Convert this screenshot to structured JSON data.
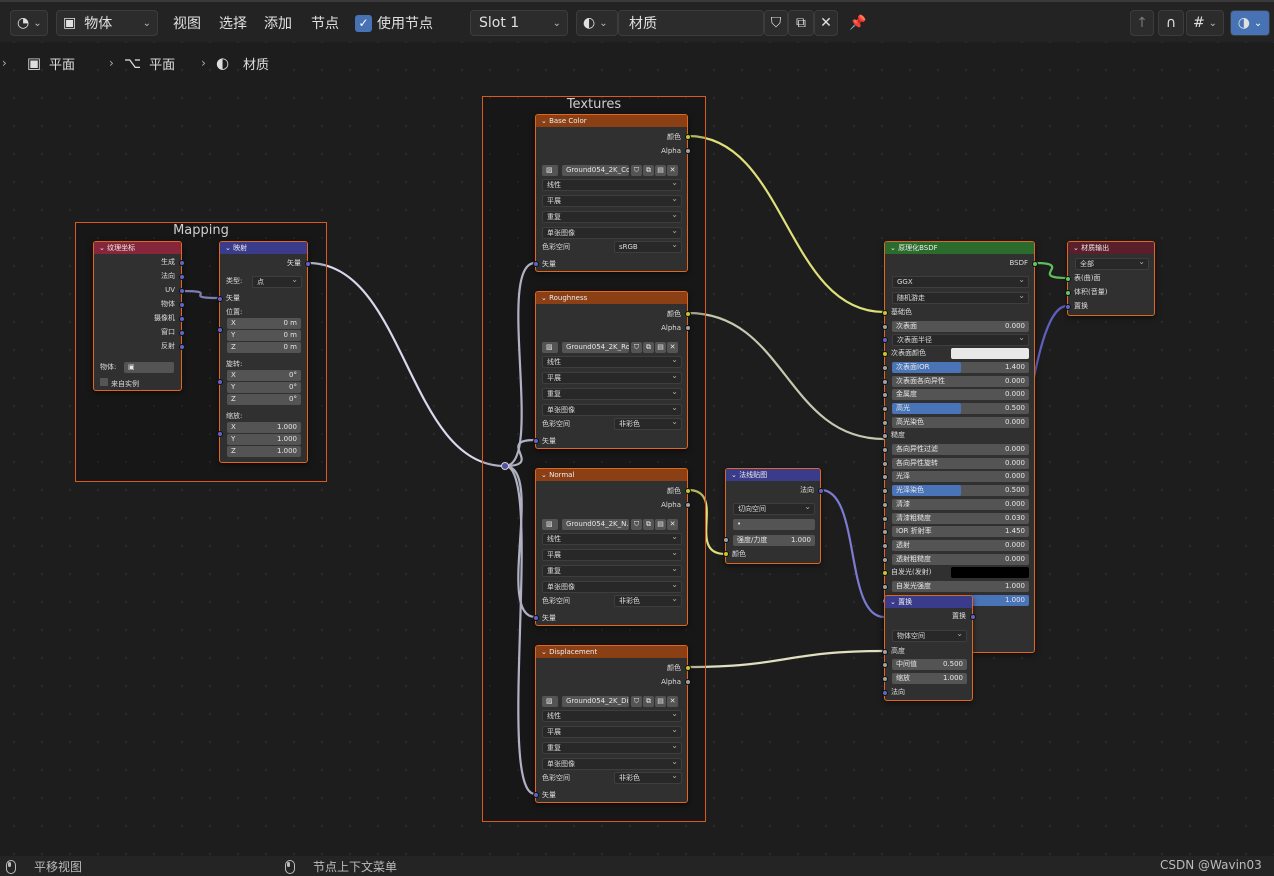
{
  "toolbar": {
    "object_mode": "物体",
    "menu": [
      "视图",
      "选择",
      "添加",
      "节点"
    ],
    "use_nodes": "使用节点",
    "slot": "Slot 1",
    "material": "材质"
  },
  "breadcrumb": [
    "平面",
    "平面",
    "材质"
  ],
  "frames": {
    "mapping": "Mapping",
    "textures": "Textures"
  },
  "texcoord": {
    "title": "纹理坐标",
    "outputs": [
      "生成",
      "法向",
      "UV",
      "物体",
      "摄像机",
      "窗口",
      "反射"
    ],
    "object_label": "物体:",
    "from_instancer": "来自实例"
  },
  "mapping": {
    "title": "映射",
    "out": "矢量",
    "type_label": "类型:",
    "type": "点",
    "vector": "矢量",
    "location": "位置:",
    "rotation": "旋转:",
    "scale": "缩放:",
    "loc": [
      [
        "X",
        "0 m"
      ],
      [
        "Y",
        "0 m"
      ],
      [
        "Z",
        "0 m"
      ]
    ],
    "rot": [
      [
        "X",
        "0°"
      ],
      [
        "Y",
        "0°"
      ],
      [
        "Z",
        "0°"
      ]
    ],
    "scl": [
      [
        "X",
        "1.000"
      ],
      [
        "Y",
        "1.000"
      ],
      [
        "Z",
        "1.000"
      ]
    ]
  },
  "tex_common": {
    "color": "颜色",
    "alpha": "Alpha",
    "opts": [
      "线性",
      "平展",
      "重复",
      "单张图像"
    ],
    "cs_label": "色彩空间",
    "vector": "矢量"
  },
  "textures": [
    {
      "title": "Base Color",
      "image": "Ground054_2K_Co...",
      "cs": "sRGB"
    },
    {
      "title": "Roughness",
      "image": "Ground054_2K_Ro...",
      "cs": "非彩色"
    },
    {
      "title": "Normal",
      "image": "Ground054_2K_N...",
      "cs": "非彩色"
    },
    {
      "title": "Displacement",
      "image": "Ground054_2K_Di...",
      "cs": "非彩色"
    }
  ],
  "normalmap": {
    "title": "法线贴图",
    "out": "法向",
    "space": "切向空间",
    "uv": "•",
    "strength_label": "强度/力度",
    "strength": "1.000",
    "color": "颜色"
  },
  "bsdf": {
    "title": "原理化BSDF",
    "out": "BSDF",
    "dist": "GGX",
    "sss": "随机游走",
    "rows": [
      {
        "label": "基础色",
        "kind": "sock"
      },
      {
        "label": "次表面",
        "value": "0.000"
      },
      {
        "label": "次表面半径",
        "kind": "select"
      },
      {
        "label": "次表面颜色",
        "kind": "color"
      },
      {
        "label": "次表面IOR",
        "value": "1.400",
        "fill": 0.5
      },
      {
        "label": "次表面各向异性",
        "value": "0.000"
      },
      {
        "label": "金属度",
        "value": "0.000"
      },
      {
        "label": "高光",
        "value": "0.500",
        "fill": 0.5
      },
      {
        "label": "高光染色",
        "value": "0.000"
      },
      {
        "label": "糙度",
        "kind": "sock"
      },
      {
        "label": "各向异性过滤",
        "value": "0.000"
      },
      {
        "label": "各向异性旋转",
        "value": "0.000"
      },
      {
        "label": "光泽",
        "value": "0.000"
      },
      {
        "label": "光泽染色",
        "value": "0.500",
        "fill": 0.5
      },
      {
        "label": "清漆",
        "value": "0.000"
      },
      {
        "label": "清漆粗糙度",
        "value": "0.030"
      },
      {
        "label": "IOR 折射率",
        "value": "1.450"
      },
      {
        "label": "透射",
        "value": "0.000"
      },
      {
        "label": "透射粗糙度",
        "value": "0.000"
      },
      {
        "label": "自发光(发射)",
        "kind": "black"
      },
      {
        "label": "自发光强度",
        "value": "1.000"
      },
      {
        "label": "",
        "value": "1.000",
        "fill": 1
      }
    ]
  },
  "output": {
    "title": "材质输出",
    "target": "全部",
    "inputs": [
      "表(曲)面",
      "体积(音量)",
      "置换"
    ]
  },
  "displacement": {
    "title": "置换",
    "out": "置换",
    "space": "物体空间",
    "height": "高度",
    "midlevel_label": "中间值",
    "midlevel": "0.500",
    "scale_label": "缩放",
    "scale": "1.000",
    "normal": "法向"
  },
  "status": {
    "pan": "平移视图",
    "context": "节点上下文菜单",
    "watermark": "CSDN @Wavin03"
  },
  "colors": {
    "frame": "#d95a1a",
    "tex_header": "#8a3f14",
    "vec_header": "#3b3b8c",
    "shader_header": "#2b6b2b",
    "yellow": "#c7c729",
    "gray": "#a1a1a1",
    "purple": "#6363c7",
    "green": "#63c763"
  }
}
